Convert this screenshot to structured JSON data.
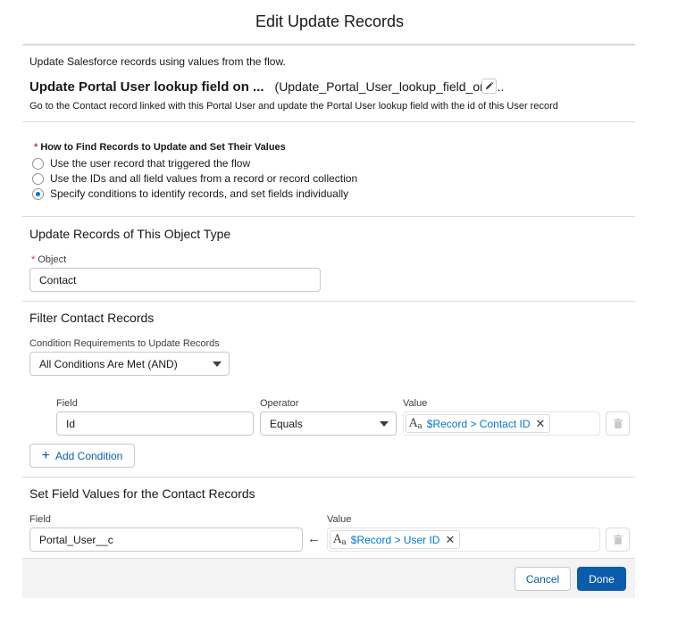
{
  "dialog": {
    "title": "Edit Update Records"
  },
  "intro": "Update Salesforce records using values from the flow.",
  "element": {
    "label": "Update Portal User lookup field on ...",
    "api_name": "(Update_Portal_User_lookup_field_on_...",
    "description": "Go to the Contact record linked with this Portal User and update the Portal User lookup field with the id of this User record"
  },
  "how_to_find": {
    "label": "How to Find Records to Update and Set Their Values",
    "options": [
      {
        "label": "Use the user record that triggered the flow",
        "selected": false
      },
      {
        "label": "Use the IDs and all field values from a record or record collection",
        "selected": false
      },
      {
        "label": "Specify conditions to identify records, and set fields individually",
        "selected": true
      }
    ]
  },
  "object_section": {
    "heading": "Update Records of This Object Type",
    "object_label": "Object",
    "object_value": "Contact"
  },
  "filter_section": {
    "heading": "Filter Contact Records",
    "requirements_label": "Condition Requirements to Update Records",
    "requirements_value": "All Conditions Are Met (AND)",
    "col_field": "Field",
    "col_operator": "Operator",
    "col_value": "Value",
    "condition": {
      "field": "Id",
      "operator": "Equals",
      "value": "$Record > Contact ID"
    },
    "add_condition_label": "Add Condition"
  },
  "set_section": {
    "heading": "Set Field Values for the Contact Records",
    "col_field": "Field",
    "col_value": "Value",
    "assignment": {
      "field": "Portal_User__c",
      "value": "$Record > User ID"
    }
  },
  "footer": {
    "cancel_label": "Cancel",
    "done_label": "Done"
  },
  "colors": {
    "brand": "#0b5cab",
    "link": "#0176d3",
    "required": "#c23934"
  }
}
